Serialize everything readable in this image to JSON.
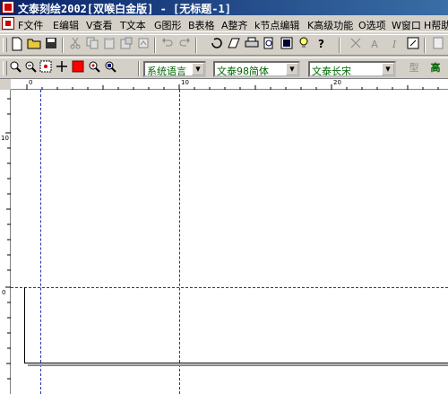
{
  "window": {
    "title": "文泰刻绘2002[双喉白金版] - [无标题-1]"
  },
  "menu": [
    {
      "label": "F文件"
    },
    {
      "label": "E编辑"
    },
    {
      "label": "V查看"
    },
    {
      "label": "T文本"
    },
    {
      "label": "G图形"
    },
    {
      "label": "B表格"
    },
    {
      "label": "A整齐"
    },
    {
      "label": "k节点编辑"
    },
    {
      "label": "K高级功能"
    },
    {
      "label": "O选项"
    },
    {
      "label": "W窗口"
    },
    {
      "label": "H帮助"
    }
  ],
  "toolbar_text": {
    "italic": "I",
    "outline_A": "A"
  },
  "combos": {
    "language": "系统语言",
    "font": "文泰98简体",
    "style": "文泰长宋"
  },
  "tail_labels": {
    "type_btn": "型",
    "high_btn": "高"
  },
  "ruler": {
    "top_numbers": [
      "0",
      "10",
      "20"
    ],
    "left_numbers": [
      "10",
      "0"
    ]
  },
  "colors": {
    "title_bar": "#0a246a",
    "color_swatch": "#ff0000",
    "guide": "#2233aa"
  }
}
